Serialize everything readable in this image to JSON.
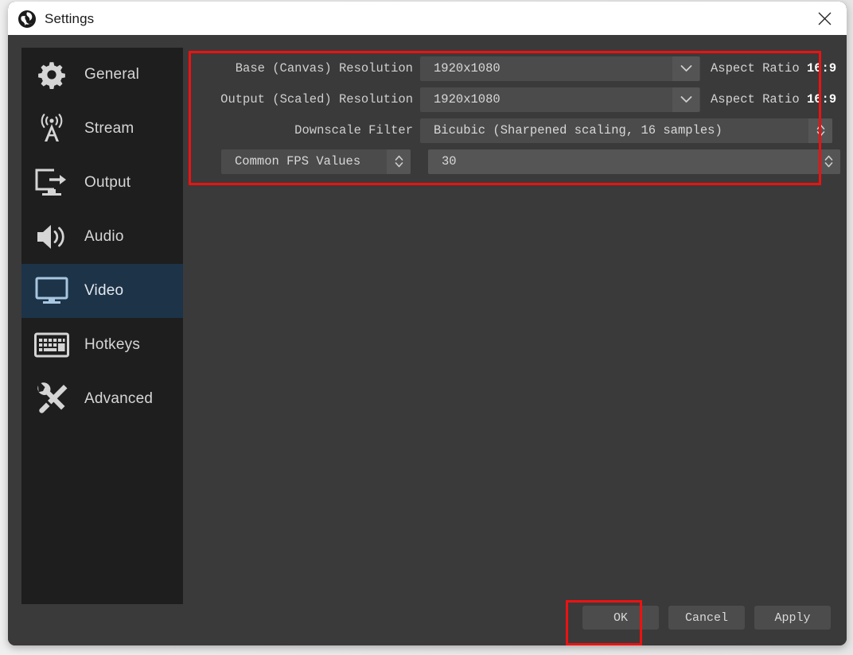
{
  "window": {
    "title": "Settings",
    "close_icon": "close-icon",
    "logo_icon": "obs-logo-icon"
  },
  "sidebar": {
    "items": [
      {
        "label": "General",
        "icon": "gear-icon",
        "selected": false
      },
      {
        "label": "Stream",
        "icon": "broadcast-icon",
        "selected": false
      },
      {
        "label": "Output",
        "icon": "output-icon",
        "selected": false
      },
      {
        "label": "Audio",
        "icon": "speaker-icon",
        "selected": false
      },
      {
        "label": "Video",
        "icon": "monitor-icon",
        "selected": true
      },
      {
        "label": "Hotkeys",
        "icon": "keyboard-icon",
        "selected": false
      },
      {
        "label": "Advanced",
        "icon": "tools-icon",
        "selected": false
      }
    ]
  },
  "video_settings": {
    "base_resolution": {
      "label": "Base (Canvas) Resolution",
      "value": "1920x1080",
      "aspect_label": "Aspect Ratio",
      "aspect_value": "16:9",
      "dropdown_icon": "chevron-down-icon"
    },
    "output_resolution": {
      "label": "Output (Scaled) Resolution",
      "value": "1920x1080",
      "aspect_label": "Aspect Ratio",
      "aspect_value": "16:9",
      "dropdown_icon": "chevron-down-icon"
    },
    "downscale_filter": {
      "label": "Downscale Filter",
      "value": "Bicubic (Sharpened scaling, 16 samples)",
      "spinner_icon": "spinner-updown-icon"
    },
    "fps": {
      "type_label": "Common FPS Values",
      "value": "30",
      "type_spinner_icon": "spinner-updown-icon",
      "value_spinner_icon": "spinner-updown-icon"
    }
  },
  "footer": {
    "ok_label": "OK",
    "cancel_label": "Cancel",
    "apply_label": "Apply"
  },
  "annotations": {
    "color": "#ee1111",
    "boxes": [
      "video-settings-group",
      "ok-button"
    ]
  }
}
